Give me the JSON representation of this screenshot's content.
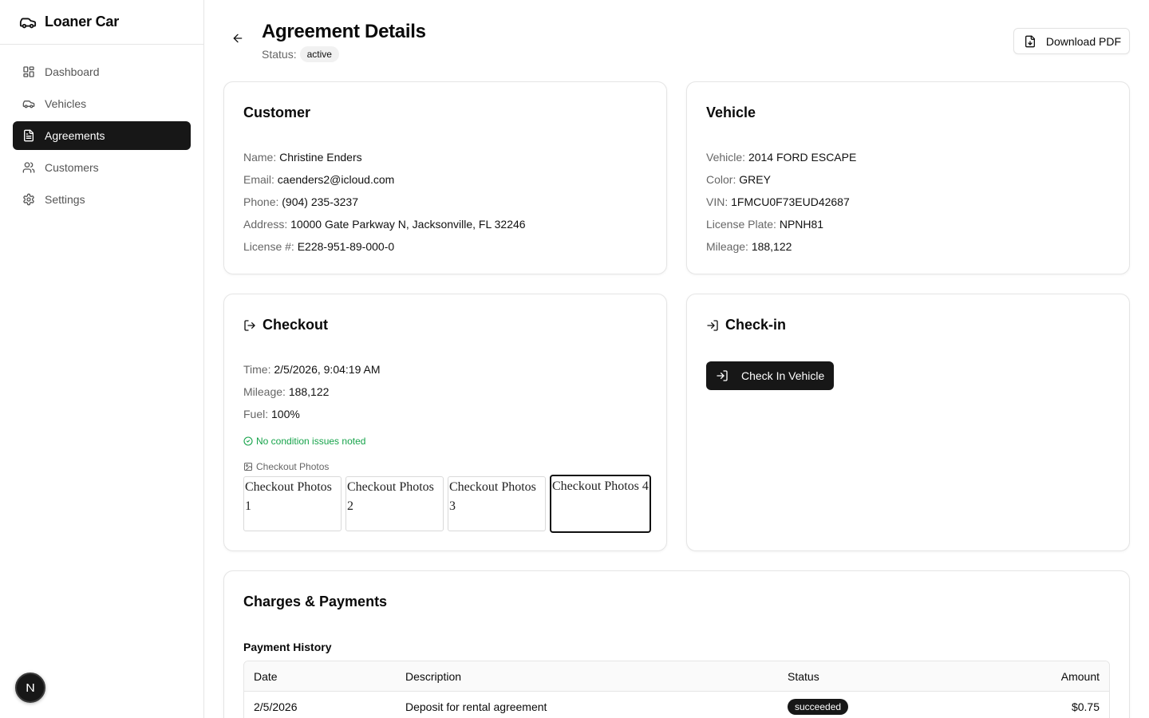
{
  "app": {
    "name": "Loaner Car"
  },
  "sidebar": {
    "items": [
      {
        "label": "Dashboard",
        "icon": "dashboard-icon",
        "active": false
      },
      {
        "label": "Vehicles",
        "icon": "car-icon",
        "active": false
      },
      {
        "label": "Agreements",
        "icon": "file-text-icon",
        "active": true
      },
      {
        "label": "Customers",
        "icon": "users-icon",
        "active": false
      },
      {
        "label": "Settings",
        "icon": "gear-icon",
        "active": false
      }
    ],
    "badge": "N"
  },
  "header": {
    "title": "Agreement Details",
    "status_label": "Status:",
    "status_value": "active",
    "download_label": "Download PDF"
  },
  "customer": {
    "title": "Customer",
    "fields": [
      {
        "label": "Name:",
        "value": "Christine Enders"
      },
      {
        "label": "Email:",
        "value": "caenders2@icloud.com"
      },
      {
        "label": "Phone:",
        "value": "(904) 235-3237"
      },
      {
        "label": "Address:",
        "value": "10000 Gate Parkway N, Jacksonville, FL 32246"
      },
      {
        "label": "License #:",
        "value": "E228-951-89-000-0"
      }
    ]
  },
  "vehicle": {
    "title": "Vehicle",
    "fields": [
      {
        "label": "Vehicle:",
        "value": "2014 FORD ESCAPE"
      },
      {
        "label": "Color:",
        "value": "GREY"
      },
      {
        "label": "VIN:",
        "value": "1FMCU0F73EUD42687"
      },
      {
        "label": "License Plate:",
        "value": "NPNH81"
      },
      {
        "label": "Mileage:",
        "value": "188,122"
      }
    ]
  },
  "checkout": {
    "title": "Checkout",
    "fields": [
      {
        "label": "Time:",
        "value": "2/5/2026, 9:04:19 AM"
      },
      {
        "label": "Mileage:",
        "value": "188,122"
      },
      {
        "label": "Fuel:",
        "value": "100%"
      }
    ],
    "condition_note": "No condition issues noted",
    "photos_label": "Checkout Photos",
    "photos": [
      "Checkout Photos 1",
      "Checkout Photos 2",
      "Checkout Photos 3",
      "Checkout Photos 4"
    ]
  },
  "checkin": {
    "title": "Check-in",
    "button_label": "Check In Vehicle"
  },
  "charges": {
    "title": "Charges & Payments",
    "subtitle": "Payment History",
    "columns": [
      "Date",
      "Description",
      "Status",
      "Amount"
    ],
    "rows": [
      {
        "date": "2/5/2026",
        "description": "Deposit for rental agreement",
        "status": "succeeded",
        "amount": "$0.75"
      }
    ]
  },
  "colors": {
    "accent": "#171717",
    "success": "#16a34a",
    "muted": "#666666"
  }
}
